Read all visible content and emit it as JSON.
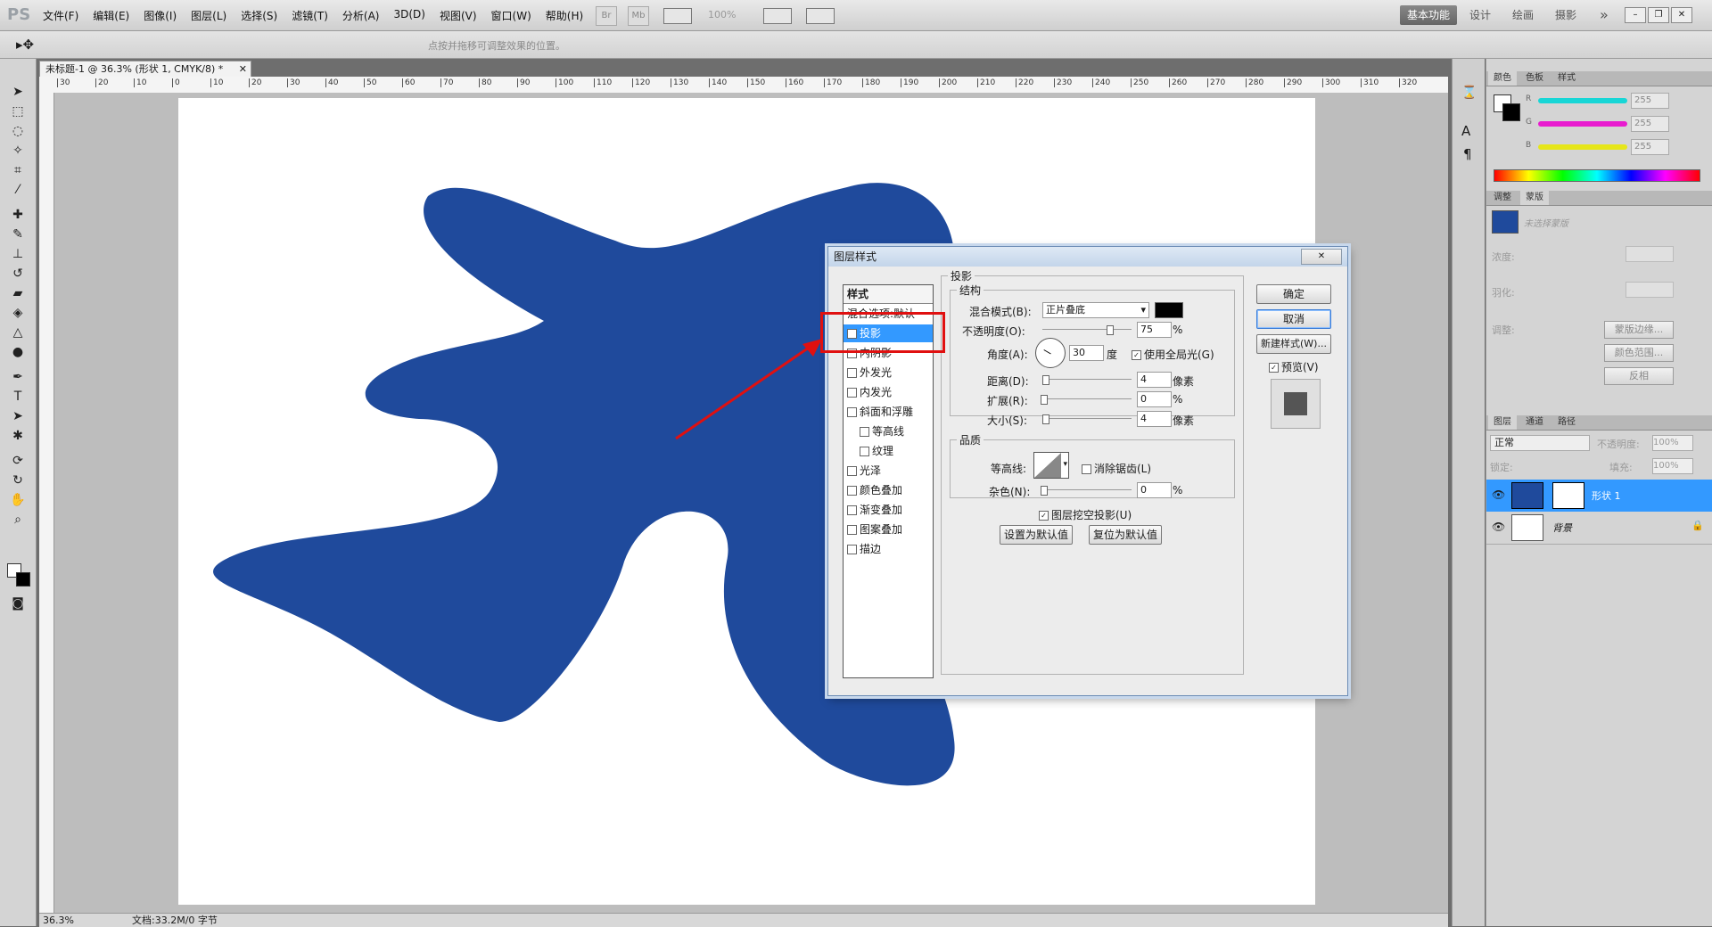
{
  "app": {
    "logo": "PS",
    "menu": [
      "文件(F)",
      "编辑(E)",
      "图像(I)",
      "图层(L)",
      "选择(S)",
      "滤镜(T)",
      "分析(A)",
      "3D(D)",
      "视图(V)",
      "窗口(W)",
      "帮助(H)"
    ],
    "toolbar_br": "Br",
    "toolbar_mb": "Mb",
    "zoom_select": "100%",
    "workspaces": [
      "基本功能",
      "设计",
      "绘画",
      "摄影"
    ],
    "workspace_more": "»"
  },
  "options_bar": {
    "hint": "点按并拖移可调整效果的位置。"
  },
  "document": {
    "tab_title": "未标题-1 @ 36.3% (形状 1, CMYK/8) *",
    "zoom": "36.3%",
    "doc_info": "文档:33.2M/0 字节",
    "ruler_h": [
      "30",
      "20",
      "10",
      "0",
      "10",
      "20",
      "30",
      "40",
      "50",
      "60",
      "70",
      "80",
      "90",
      "100",
      "110",
      "120",
      "130",
      "140",
      "150",
      "160",
      "170",
      "180",
      "190",
      "200",
      "210",
      "220",
      "230",
      "240",
      "250",
      "260",
      "270",
      "280",
      "290",
      "300",
      "310",
      "320"
    ],
    "shape_color": "#1f4a9c"
  },
  "dialog": {
    "title": "图层样式",
    "close": "✕",
    "styles_header": "样式",
    "styles": [
      {
        "label": "混合选项:默认",
        "checkbox": false,
        "checked": false,
        "indent": false
      },
      {
        "label": "投影",
        "checkbox": true,
        "checked": true,
        "indent": false,
        "selected": true
      },
      {
        "label": "内阴影",
        "checkbox": true,
        "checked": false,
        "indent": false
      },
      {
        "label": "外发光",
        "checkbox": true,
        "checked": false,
        "indent": false
      },
      {
        "label": "内发光",
        "checkbox": true,
        "checked": false,
        "indent": false
      },
      {
        "label": "斜面和浮雕",
        "checkbox": true,
        "checked": false,
        "indent": false
      },
      {
        "label": "等高线",
        "checkbox": true,
        "checked": false,
        "indent": true
      },
      {
        "label": "纹理",
        "checkbox": true,
        "checked": false,
        "indent": true
      },
      {
        "label": "光泽",
        "checkbox": true,
        "checked": false,
        "indent": false
      },
      {
        "label": "颜色叠加",
        "checkbox": true,
        "checked": false,
        "indent": false
      },
      {
        "label": "渐变叠加",
        "checkbox": true,
        "checked": false,
        "indent": false
      },
      {
        "label": "图案叠加",
        "checkbox": true,
        "checked": false,
        "indent": false
      },
      {
        "label": "描边",
        "checkbox": true,
        "checked": false,
        "indent": false
      }
    ],
    "section_title": "投影",
    "structure": {
      "title": "结构",
      "blend_mode_label": "混合模式(B):",
      "blend_mode_value": "正片叠底",
      "shadow_color": "#000000",
      "opacity_label": "不透明度(O):",
      "opacity_value": "75",
      "opacity_unit": "%",
      "opacity_fraction": 0.75,
      "angle_label": "角度(A):",
      "angle_value": "30",
      "angle_unit": "度",
      "global_light_label": "使用全局光(G)",
      "global_light_checked": true,
      "distance_label": "距离(D):",
      "distance_value": "4",
      "distance_unit": "像素",
      "spread_label": "扩展(R):",
      "spread_value": "0",
      "spread_unit": "%",
      "size_label": "大小(S):",
      "size_value": "4",
      "size_unit": "像素"
    },
    "quality": {
      "title": "品质",
      "contour_label": "等高线:",
      "antialias_label": "消除锯齿(L)",
      "antialias_checked": false,
      "noise_label": "杂色(N):",
      "noise_value": "0",
      "noise_unit": "%"
    },
    "knockout_label": "图层挖空投影(U)",
    "knockout_checked": true,
    "set_default": "设置为默认值",
    "reset_default": "复位为默认值",
    "ok": "确定",
    "cancel": "取消",
    "new_style": "新建样式(W)...",
    "preview_label": "预览(V)",
    "preview_checked": true
  },
  "panels": {
    "color_tabs": [
      "颜色",
      "色板",
      "样式"
    ],
    "rgb": [
      {
        "label": "R",
        "value": "255",
        "color": "#18d6d6"
      },
      {
        "label": "G",
        "value": "255",
        "color": "#e81ccf"
      },
      {
        "label": "B",
        "value": "255",
        "color": "#e6e61a"
      }
    ],
    "adjust_tabs": [
      "调整",
      "蒙版"
    ],
    "mask_placeholder": "未选择蒙版",
    "density_label": "浓度:",
    "feather_label": "羽化:",
    "refine_label": "调整:",
    "mask_edge": "蒙版边缘...",
    "color_range": "颜色范围...",
    "invert": "反相",
    "layers_tabs": [
      "图层",
      "通道",
      "路径"
    ],
    "blend_mode": "正常",
    "opacity_label": "不透明度:",
    "opacity_value": "100%",
    "lock_label": "锁定:",
    "fill_label": "填充:",
    "fill_value": "100%",
    "layers": [
      {
        "name": "形状 1",
        "selected": true,
        "thumb": "#1f4a9c"
      },
      {
        "name": "背景",
        "selected": false,
        "thumb": "#ffffff",
        "locked": true
      }
    ]
  }
}
